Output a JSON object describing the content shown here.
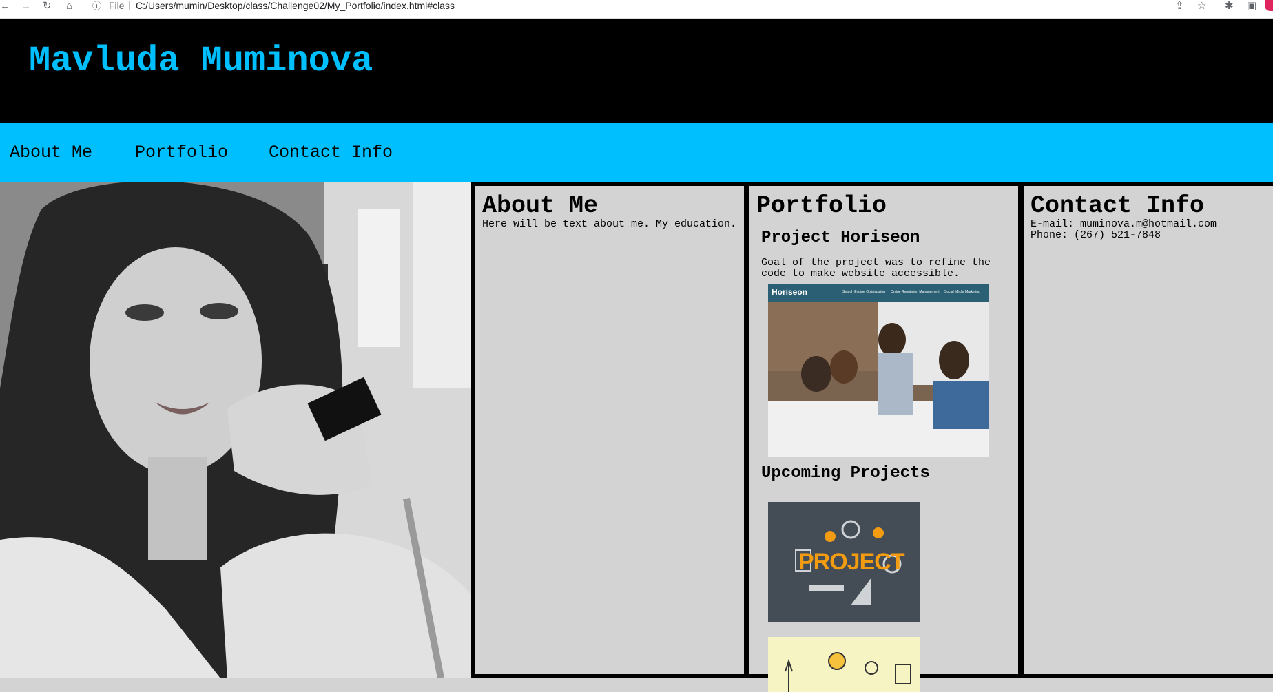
{
  "browser": {
    "file_label": "File",
    "url": "C:/Users/mumin/Desktop/class/Challenge02/My_Portfolio/index.html#class"
  },
  "header": {
    "name": "Mavluda Muminova"
  },
  "nav": {
    "items": [
      "About Me",
      "Portfolio",
      "Contact Info"
    ]
  },
  "about": {
    "title": "About Me",
    "text": "Here will be text about me. My education."
  },
  "portfolio": {
    "title": "Portfolio",
    "project_title": "Project Horiseon",
    "project_desc": "Goal of the project was to refine the code to make website accessible.",
    "project_image": {
      "brand": "Horiseon",
      "menu": [
        "Search Engine Optimization",
        "Online Reputation Management",
        "Social Media Marketing"
      ]
    },
    "upcoming_title": "Upcoming Projects",
    "upcoming_image_word": "PROJECT"
  },
  "contact": {
    "title": "Contact Info",
    "email": "E-mail: muminova.m@hotmail.com",
    "phone": "Phone: (267) 521-7848"
  },
  "colors": {
    "accent": "#00bfff",
    "header_bg": "#000000",
    "panel_bg": "#d3d3d3"
  }
}
